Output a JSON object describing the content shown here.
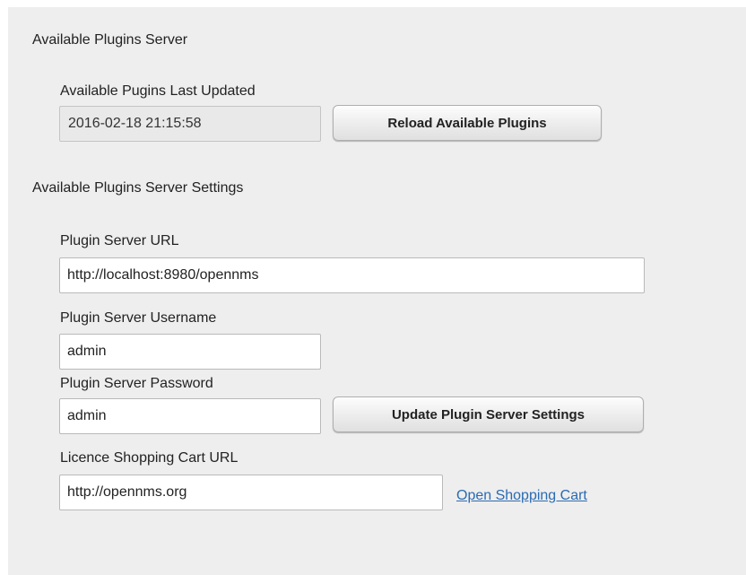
{
  "sections": {
    "available_plugins_server": {
      "title": "Available Plugins Server",
      "last_updated_label": "Available Pugins Last Updated",
      "last_updated_value": "2016-02-18 21:15:58",
      "reload_button_label": "Reload Available Plugins"
    },
    "server_settings": {
      "title": "Available Plugins Server Settings",
      "url_label": "Plugin Server URL",
      "url_value": "http://localhost:8980/opennms",
      "username_label": "Plugin Server Username",
      "username_value": "admin",
      "password_label": "Plugin Server Password",
      "password_value": "admin",
      "update_button_label": "Update Plugin Server Settings",
      "cart_url_label": "Licence Shopping Cart URL",
      "cart_url_value": "http://opennms.org",
      "open_cart_link_label": "Open Shopping Cart"
    }
  },
  "colors": {
    "panel_background": "#eeeeee",
    "link": "#2a6bb3"
  }
}
